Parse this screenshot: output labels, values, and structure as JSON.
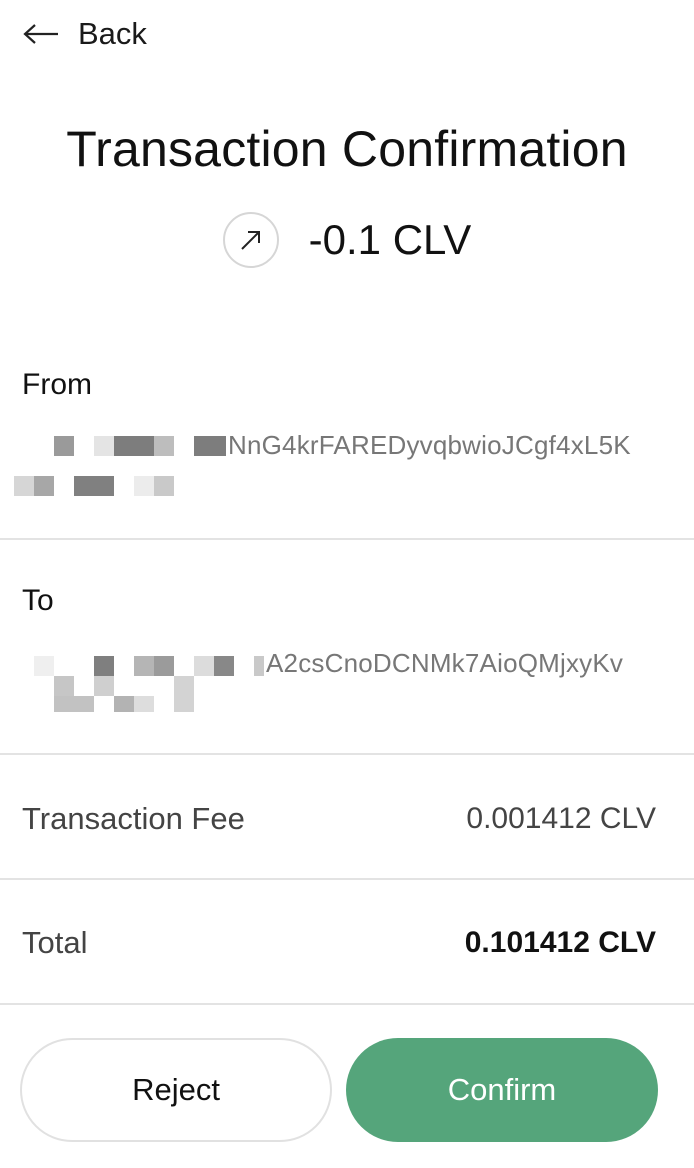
{
  "header": {
    "back_label": "Back"
  },
  "title": "Transaction Confirmation",
  "amount": {
    "icon": "arrow-up-right-icon",
    "value": "-0.1 CLV"
  },
  "from": {
    "label": "From",
    "address_visible_part": "NnG4krFAREDyvqbwioJCgf4xL5K"
  },
  "to": {
    "label": "To",
    "address_visible_part": "A2csCnoDCNMk7AioQMjxyKv"
  },
  "fee": {
    "label": "Transaction Fee",
    "value": "0.001412 CLV"
  },
  "total": {
    "label": "Total",
    "value": "0.101412 CLV"
  },
  "buttons": {
    "reject": "Reject",
    "confirm": "Confirm"
  },
  "colors": {
    "confirm_button": "#55a57b",
    "divider": "#e3e3e3",
    "muted_text": "#777777"
  }
}
